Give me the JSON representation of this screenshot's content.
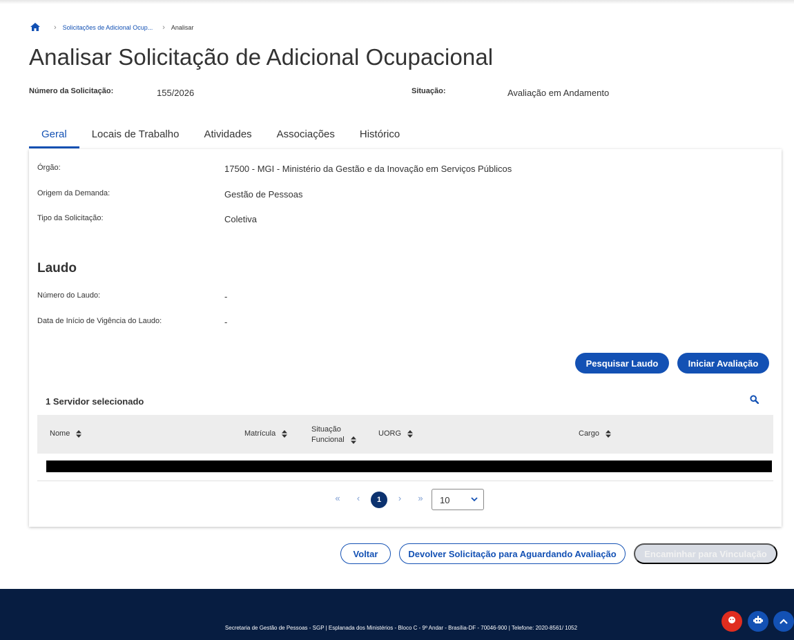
{
  "breadcrumb": {
    "home_icon": "home-icon",
    "items": [
      "Solicitações de Adicional Ocup...",
      "Analisar"
    ]
  },
  "page": {
    "title": "Analisar Solicitação de Adicional Ocupacional"
  },
  "summary": {
    "numero_label": "Número da Solicitação:",
    "numero_value": "155/2026",
    "situacao_label": "Situação:",
    "situacao_value": "Avaliação em Andamento"
  },
  "tabs": [
    {
      "label": "Geral",
      "active": true
    },
    {
      "label": "Locais de Trabalho",
      "active": false
    },
    {
      "label": "Atividades",
      "active": false
    },
    {
      "label": "Associações",
      "active": false
    },
    {
      "label": "Histórico",
      "active": false
    }
  ],
  "geral": {
    "fields": [
      {
        "label": "Órgão:",
        "value": "17500 - MGI - Ministério da Gestão e da Inovação em Serviços Públicos"
      },
      {
        "label": "Origem da Demanda:",
        "value": "Gestão de Pessoas"
      },
      {
        "label": "Tipo da Solicitação:",
        "value": "Coletiva"
      }
    ]
  },
  "laudo": {
    "title": "Laudo",
    "fields": [
      {
        "label": "Número do Laudo:",
        "value": "-"
      },
      {
        "label": "Data de Início de Vigência do Laudo:",
        "value": "-"
      }
    ],
    "pesquisar_label": "Pesquisar Laudo",
    "iniciar_label": "Iniciar Avaliação"
  },
  "table": {
    "caption": "1 Servidor selecionado",
    "columns": [
      "Nome",
      "Matrícula",
      "Situação Funcional",
      "UORG",
      "Cargo"
    ],
    "situacao_col_lines": [
      "Situação",
      "Funcional"
    ]
  },
  "pagination": {
    "first": "«",
    "prev": "‹",
    "current": "1",
    "next": "›",
    "last": "»",
    "page_size": "10"
  },
  "actions": {
    "voltar": "Voltar",
    "devolver": "Devolver Solicitação para Aguardando Avaliação",
    "encaminhar": "Encaminhar para Vinculação"
  },
  "footer": {
    "text": "Secretaria de Gestão de Pessoas - SGP | Esplanada dos Ministérios - Bloco C - 9º Andar - Brasília-DF - 70046-900 | Telefone: 2020-8561/ 1052"
  },
  "colors": {
    "primary": "#1351b4",
    "footer_bg": "#071d41",
    "chat_red": "#e02d1f",
    "disabled": "#d8dce4"
  }
}
